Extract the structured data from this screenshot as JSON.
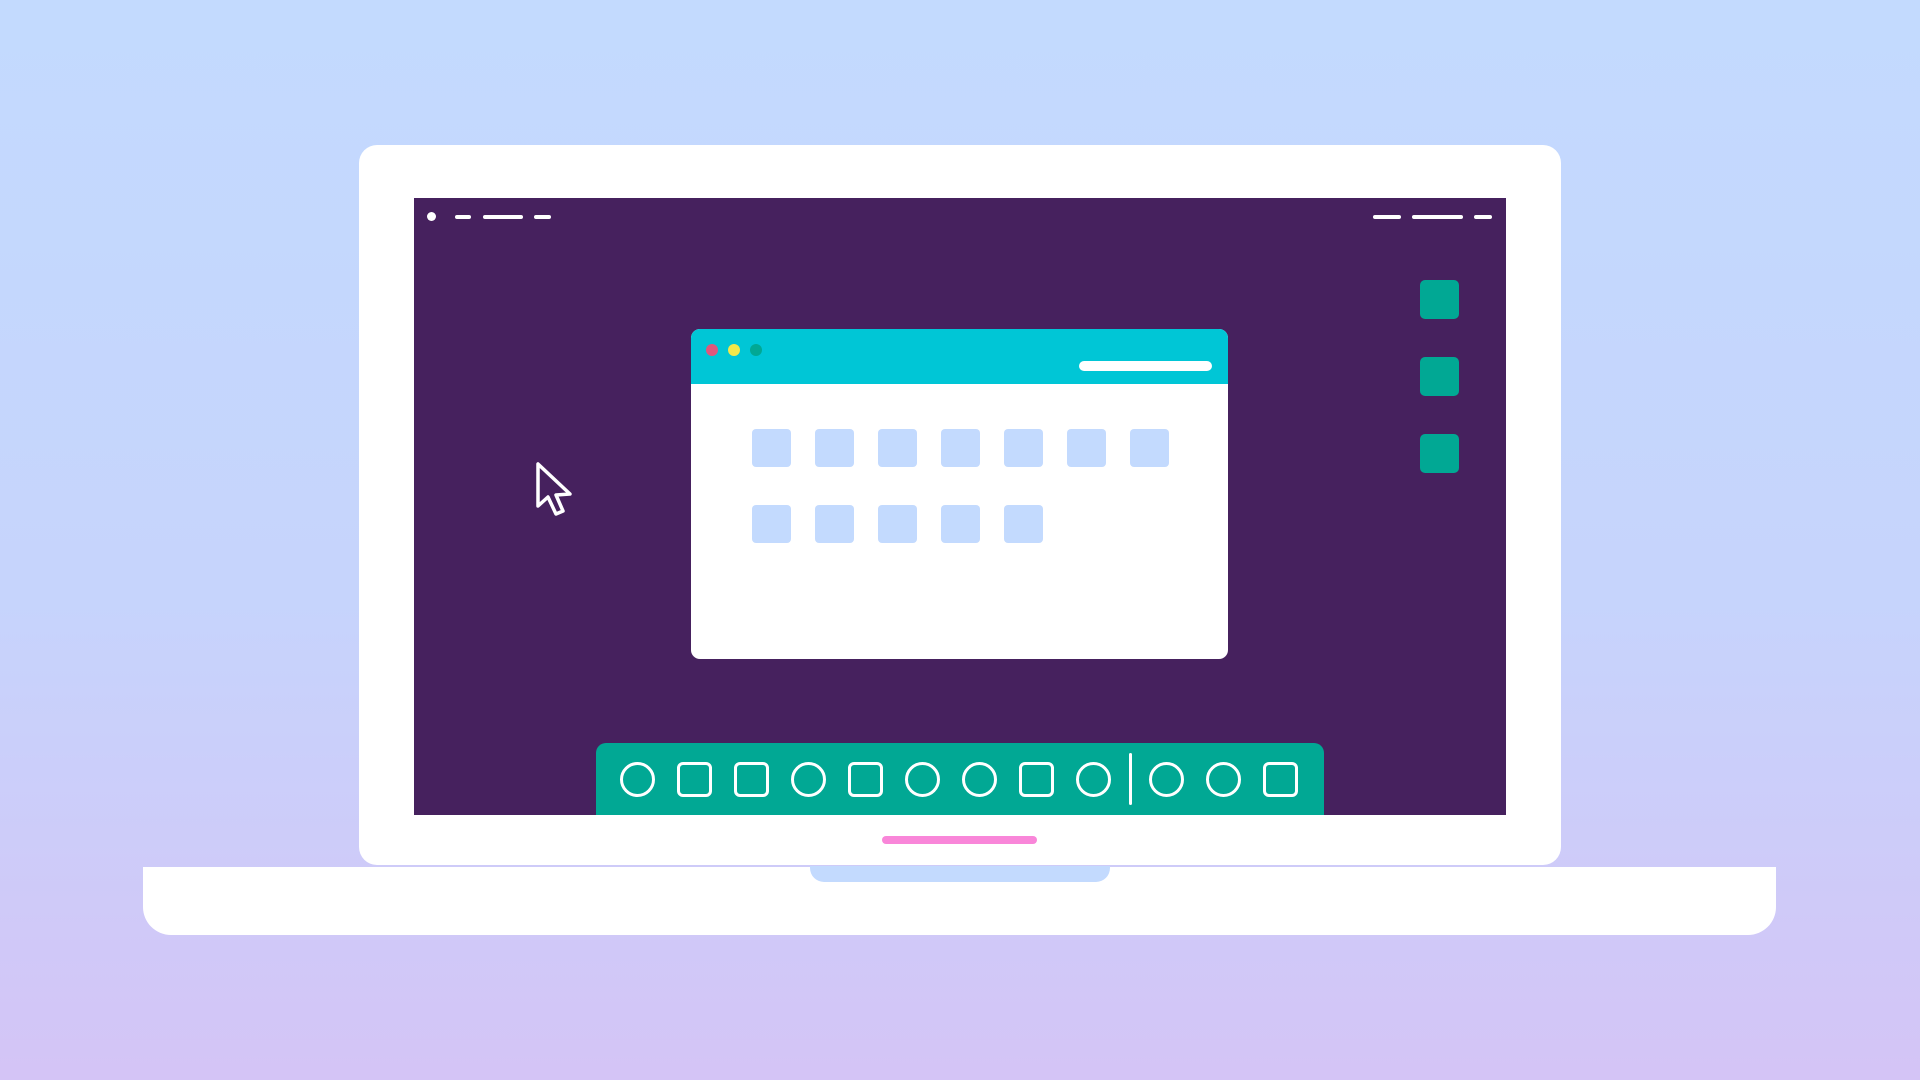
{
  "colors": {
    "screen_background": "#46215e",
    "titlebar": "#00c6d6",
    "taskbar": "#01a894",
    "desktop_icon": "#01a894",
    "tile": "#c3dafe",
    "close_button": "#e0577c",
    "minimize_button": "#f2e84a",
    "maximize_button": "#01a894",
    "indicator": "#f986d9",
    "notch": "#c3dafe"
  },
  "top_bar": {
    "left_icons": [
      "status-dot",
      "dash",
      "long-dash",
      "dash"
    ],
    "right_icons": [
      "dash",
      "long-dash",
      "dash"
    ]
  },
  "desktop_icons": [
    "app-shortcut",
    "app-shortcut",
    "app-shortcut"
  ],
  "window": {
    "controls": [
      "close",
      "minimize",
      "maximize"
    ],
    "tile_rows": [
      7,
      5
    ]
  },
  "taskbar": {
    "icons": [
      "circle",
      "square",
      "square",
      "circle",
      "square",
      "circle",
      "circle",
      "square",
      "circle",
      "separator",
      "circle",
      "circle",
      "square"
    ]
  },
  "cursor": "arrow-cursor-icon"
}
